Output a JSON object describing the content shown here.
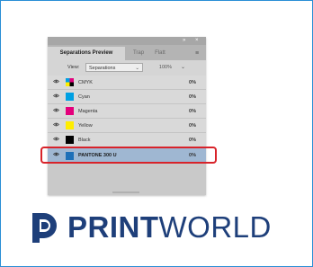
{
  "panel": {
    "close_glyph": "×",
    "collapse_glyph": "»",
    "tabs": [
      {
        "label": "Separations Preview",
        "active": true
      },
      {
        "label": "Trap",
        "active": false
      },
      {
        "label": "Flatt",
        "active": false
      }
    ],
    "menu_glyph": "≡",
    "view_label": "View:",
    "view_value": "Separations",
    "zoom_value": "100%",
    "chevron": "⌄",
    "separations": [
      {
        "name": "CMYK",
        "percent": "0%",
        "swatch": "cmyk"
      },
      {
        "name": "Cyan",
        "percent": "0%",
        "swatch": "#00a0e3"
      },
      {
        "name": "Magenta",
        "percent": "0%",
        "swatch": "#e4007c"
      },
      {
        "name": "Yellow",
        "percent": "0%",
        "swatch": "#ffed00"
      },
      {
        "name": "Black",
        "percent": "0%",
        "swatch": "#000000"
      },
      {
        "name": "PANTONE 300 U",
        "percent": "0%",
        "swatch": "#1d6fb8",
        "selected": true
      }
    ]
  },
  "logo": {
    "word_bold": "PRINT",
    "word_light": "WORLD",
    "color": "#1e3f7a"
  },
  "colors": {
    "highlight": "#d8232a",
    "frame_border": "#2a8fd6"
  }
}
